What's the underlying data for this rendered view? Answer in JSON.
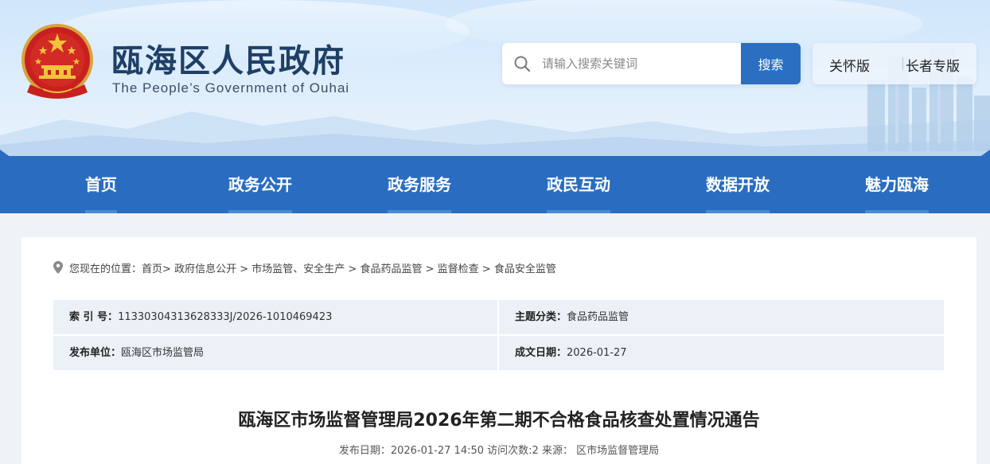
{
  "header": {
    "title": "瓯海区人民政府",
    "subtitle": "The People’s Government of Ouhai",
    "emblem_icon": "national-emblem-icon"
  },
  "search": {
    "placeholder": "请输入搜索关键词",
    "button_label": "搜索"
  },
  "modes": {
    "care_label": "关怀版",
    "elder_label": "长者专版"
  },
  "nav": {
    "items": [
      {
        "label": "首页"
      },
      {
        "label": "政务公开"
      },
      {
        "label": "政务服务"
      },
      {
        "label": "政民互动"
      },
      {
        "label": "数据开放"
      },
      {
        "label": "魅力瓯海"
      }
    ]
  },
  "breadcrumb": {
    "prefix": "您现在的位置：",
    "items": [
      "首页",
      "政府信息公开",
      "市场监管、安全生产",
      "食品药品监管",
      "监督检查",
      "食品安全监管"
    ]
  },
  "meta": {
    "index_key": "索 引 号：",
    "index_value": "11330304313628333J/2026-1010469423",
    "category_key": "主题分类：",
    "category_value": "食品药品监管",
    "publisher_key": "发布单位：",
    "publisher_value": "瓯海区市场监管局",
    "date_key": "成文日期：",
    "date_value": "2026-01-27"
  },
  "article": {
    "title": "瓯海区市场监督管理局2026年第二期不合格食品核查处置情况通告",
    "publish_label": "发布日期：",
    "publish_value": "2026-01-27 14:50",
    "visits_label": "访问次数:",
    "visits_value": "2",
    "source_label": "来源：",
    "source_value": "区市场监督管理局"
  },
  "colors": {
    "nav_blue": "#2a6dc0",
    "title_navy": "#1f3f66",
    "search_btn": "#2b6fc2",
    "meta_bg": "#ecf1f7"
  }
}
